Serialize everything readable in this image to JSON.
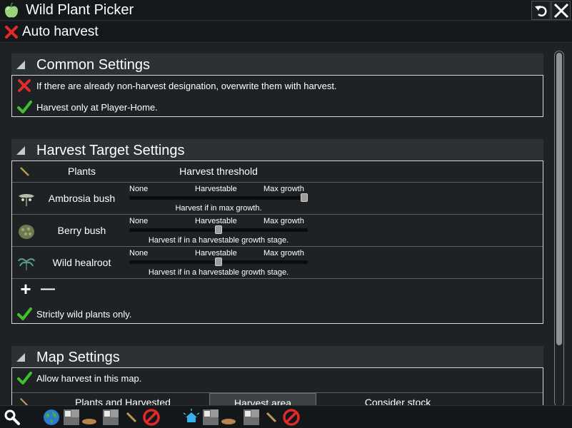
{
  "window": {
    "title": "Wild Plant Picker",
    "app_icon": "apple-icon",
    "undo_icon": "undo-icon",
    "close_icon": "close-icon"
  },
  "auto_harvest": {
    "label": "Auto harvest",
    "state": "off",
    "icon": "red-x-icon"
  },
  "common_settings": {
    "title": "Common Settings",
    "options": [
      {
        "label": "If there are already non-harvest designation, overwrite them with harvest.",
        "checked": false
      },
      {
        "label": "Harvest only at Player-Home.",
        "checked": true
      }
    ]
  },
  "harvest_target": {
    "title": "Harvest Target Settings",
    "col_plants": "Plants",
    "col_threshold": "Harvest threshold",
    "tick_labels": [
      "None",
      "Harvestable",
      "Max growth"
    ],
    "plants": [
      {
        "name": "Ambrosia bush",
        "threshold": 1.0,
        "desc": "Harvest if in max growth."
      },
      {
        "name": "Berry bush",
        "threshold": 0.5,
        "desc": "Harvest if in a harvestable growth stage."
      },
      {
        "name": "Wild healroot",
        "threshold": 0.5,
        "desc": "Harvest if in a harvestable growth stage."
      }
    ],
    "add_label": "+",
    "remove_label": "—",
    "wild_only": {
      "label": "Strictly wild plants only.",
      "checked": true
    }
  },
  "map_settings": {
    "title": "Map Settings",
    "allow": {
      "label": "Allow harvest in this map.",
      "checked": true
    },
    "tabs": [
      "Plants and Harvested",
      "Harvest area",
      "Consider stock"
    ]
  },
  "colors": {
    "check_green": "#3fc12a",
    "cross_red": "#e02a2a",
    "background": "#1e2225",
    "header_bg": "#2c3135"
  }
}
